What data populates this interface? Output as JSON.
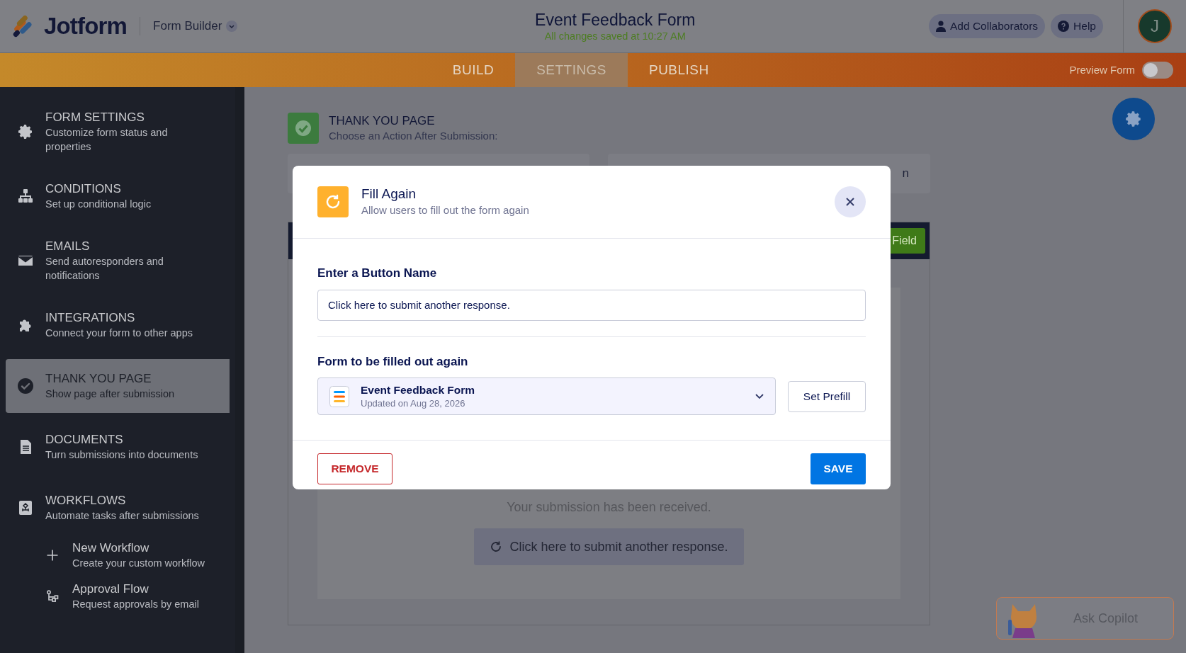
{
  "header": {
    "logo": "Jotform",
    "app_switcher": "Form Builder",
    "form_title": "Event Feedback Form",
    "save_status": "All changes saved at 10:27 AM",
    "buttons": [
      {
        "kind": "collaborators",
        "label": "Add Collaborators"
      },
      {
        "kind": "help",
        "label": "Help"
      }
    ],
    "avatar": "J"
  },
  "tabs": [
    {
      "label": "BUILD",
      "selected": false
    },
    {
      "label": "SETTINGS",
      "selected": true
    },
    {
      "label": "PUBLISH",
      "selected": false
    }
  ],
  "preview_form": {
    "label": "Preview Form",
    "on": false
  },
  "sidebar": {
    "items": [
      {
        "kind": "gear",
        "title": "FORM SETTINGS",
        "subtitle": "Customize form status and properties",
        "selected": false
      },
      {
        "kind": "conditions",
        "title": "CONDITIONS",
        "subtitle": "Set up conditional logic",
        "selected": false
      },
      {
        "kind": "email",
        "title": "EMAILS",
        "subtitle": "Send autoresponders and notifications",
        "selected": false
      },
      {
        "kind": "puzzle",
        "title": "INTEGRATIONS",
        "subtitle": "Connect your form to other apps",
        "selected": false
      },
      {
        "kind": "check",
        "title": "THANK YOU PAGE",
        "subtitle": "Show page after submission",
        "selected": true
      },
      {
        "kind": "document",
        "title": "DOCUMENTS",
        "subtitle": "Turn submissions into documents",
        "selected": false
      },
      {
        "kind": "workflow",
        "title": "WORKFLOWS",
        "subtitle": "Automate tasks after submissions",
        "selected": false,
        "children": [
          {
            "kind": "plus",
            "title": "New Workflow",
            "subtitle": "Create your custom workflow",
            "selected": false
          },
          {
            "kind": "approval",
            "title": "Approval Flow",
            "subtitle": "Request approvals by email",
            "selected": false
          }
        ]
      }
    ]
  },
  "page_header": {
    "title": "THANK YOU PAGE",
    "subtitle": "Choose an Action After Submission:"
  },
  "partial_card_text": "n",
  "partial_button_text": "Field",
  "preview": {
    "message": "Your submission has been received.",
    "button": "Click here to submit another response."
  },
  "modal": {
    "title": "Fill Again",
    "subtitle": "Allow users to fill out the form again",
    "button_name_label": "Enter a Button Name",
    "button_name_value": "Click here to submit another response.",
    "form_label": "Form to be filled out again",
    "form_name": "Event Feedback Form",
    "form_updated": "Updated on Aug 28, 2026",
    "set_prefill": "Set Prefill",
    "remove": "REMOVE",
    "save": "SAVE"
  },
  "copilot": {
    "label": "Ask Copilot"
  }
}
